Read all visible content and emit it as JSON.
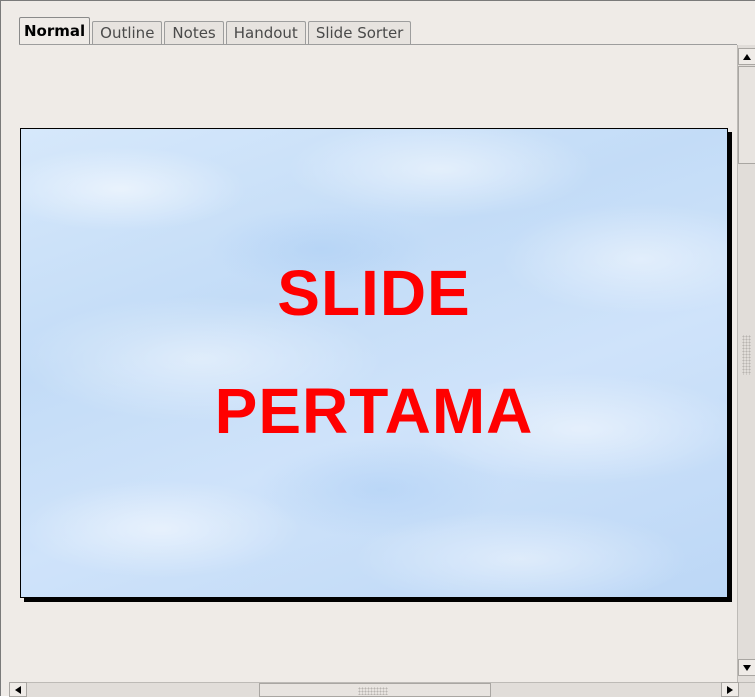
{
  "view_tabs": [
    {
      "label": "Normal",
      "active": true
    },
    {
      "label": "Outline",
      "active": false
    },
    {
      "label": "Notes",
      "active": false
    },
    {
      "label": "Handout",
      "active": false
    },
    {
      "label": "Slide Sorter",
      "active": false
    }
  ],
  "slide": {
    "title_line_1": "SLIDE",
    "title_line_2": "PERTAMA",
    "title_color": "#ff0000",
    "background_color": "#c9e0f8"
  },
  "scrollbars": {
    "vertical": {
      "up_icon": "arrow-up-icon",
      "down_icon": "arrow-down-icon"
    },
    "horizontal": {
      "left_icon": "arrow-left-icon",
      "right_icon": "arrow-right-icon"
    }
  }
}
